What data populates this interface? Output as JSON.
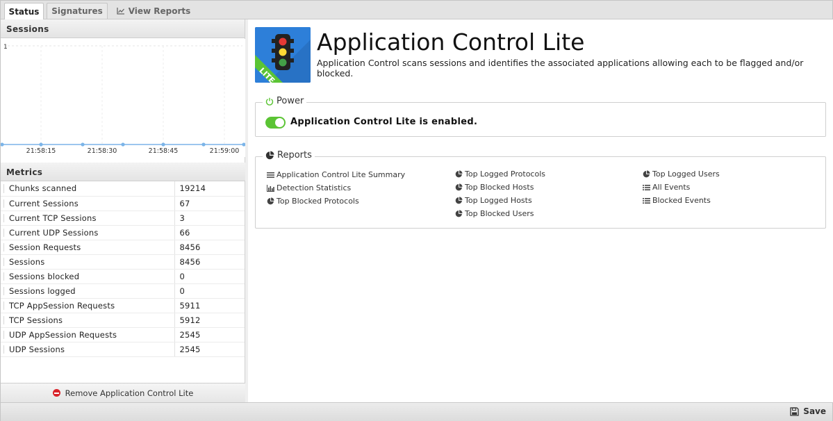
{
  "tabs": [
    {
      "label": "Status",
      "active": true
    },
    {
      "label": "Signatures",
      "active": false
    },
    {
      "label": "View Reports",
      "active": false,
      "icon": "line-chart-icon"
    }
  ],
  "sessions_panel": {
    "title": "Sessions",
    "chart_data": {
      "type": "line",
      "y_tick_labels": [
        "1"
      ],
      "x_tick_labels": [
        "21:58:15",
        "21:58:30",
        "21:58:45",
        "21:59:00"
      ],
      "series": [
        {
          "values": [
            0,
            0,
            0,
            0,
            0,
            0,
            0
          ]
        }
      ],
      "color": "#7bb4e8"
    }
  },
  "metrics_panel": {
    "title": "Metrics",
    "rows": [
      {
        "name": "Chunks scanned",
        "value": "19214"
      },
      {
        "name": "Current Sessions",
        "value": "67"
      },
      {
        "name": "Current TCP Sessions",
        "value": "3"
      },
      {
        "name": "Current UDP Sessions",
        "value": "66"
      },
      {
        "name": "Session Requests",
        "value": "8456"
      },
      {
        "name": "Sessions",
        "value": "8456"
      },
      {
        "name": "Sessions blocked",
        "value": "0"
      },
      {
        "name": "Sessions logged",
        "value": "0"
      },
      {
        "name": "TCP AppSession Requests",
        "value": "5911"
      },
      {
        "name": "TCP Sessions",
        "value": "5912"
      },
      {
        "name": "UDP AppSession Requests",
        "value": "2545"
      },
      {
        "name": "UDP Sessions",
        "value": "2545"
      }
    ]
  },
  "remove_button": {
    "label": "Remove Application Control Lite",
    "icon": "remove-circle-icon"
  },
  "app": {
    "icon": "traffic-light-icon",
    "badge": "LITE",
    "title": "Application Control Lite",
    "description": "Application Control scans sessions and identifies the associated applications allowing each to be flagged and/or blocked."
  },
  "power": {
    "legend": "Power",
    "icon": "power-icon",
    "enabled": true,
    "status_text": "Application Control Lite is enabled."
  },
  "reports": {
    "legend": "Reports",
    "icon": "pie-chart-icon",
    "columns": [
      [
        {
          "label": "Application Control Lite Summary",
          "icon": "text-lines-icon"
        },
        {
          "label": "Detection Statistics",
          "icon": "bar-chart-icon"
        },
        {
          "label": "Top Blocked Protocols",
          "icon": "pie-chart-icon"
        }
      ],
      [
        {
          "label": "Top Logged Protocols",
          "icon": "pie-chart-icon"
        },
        {
          "label": "Top Blocked Hosts",
          "icon": "pie-chart-icon"
        },
        {
          "label": "Top Logged Hosts",
          "icon": "pie-chart-icon"
        },
        {
          "label": "Top Blocked Users",
          "icon": "pie-chart-icon"
        }
      ],
      [
        {
          "label": "Top Logged Users",
          "icon": "pie-chart-icon"
        },
        {
          "label": "All Events",
          "icon": "list-icon"
        },
        {
          "label": "Blocked Events",
          "icon": "list-icon"
        }
      ]
    ]
  },
  "footer": {
    "save_label": "Save",
    "save_icon": "save-disk-icon"
  },
  "colors": {
    "accent_green": "#5bc434",
    "app_blue": "#2d7fd9",
    "remove_red": "#d9232a"
  }
}
